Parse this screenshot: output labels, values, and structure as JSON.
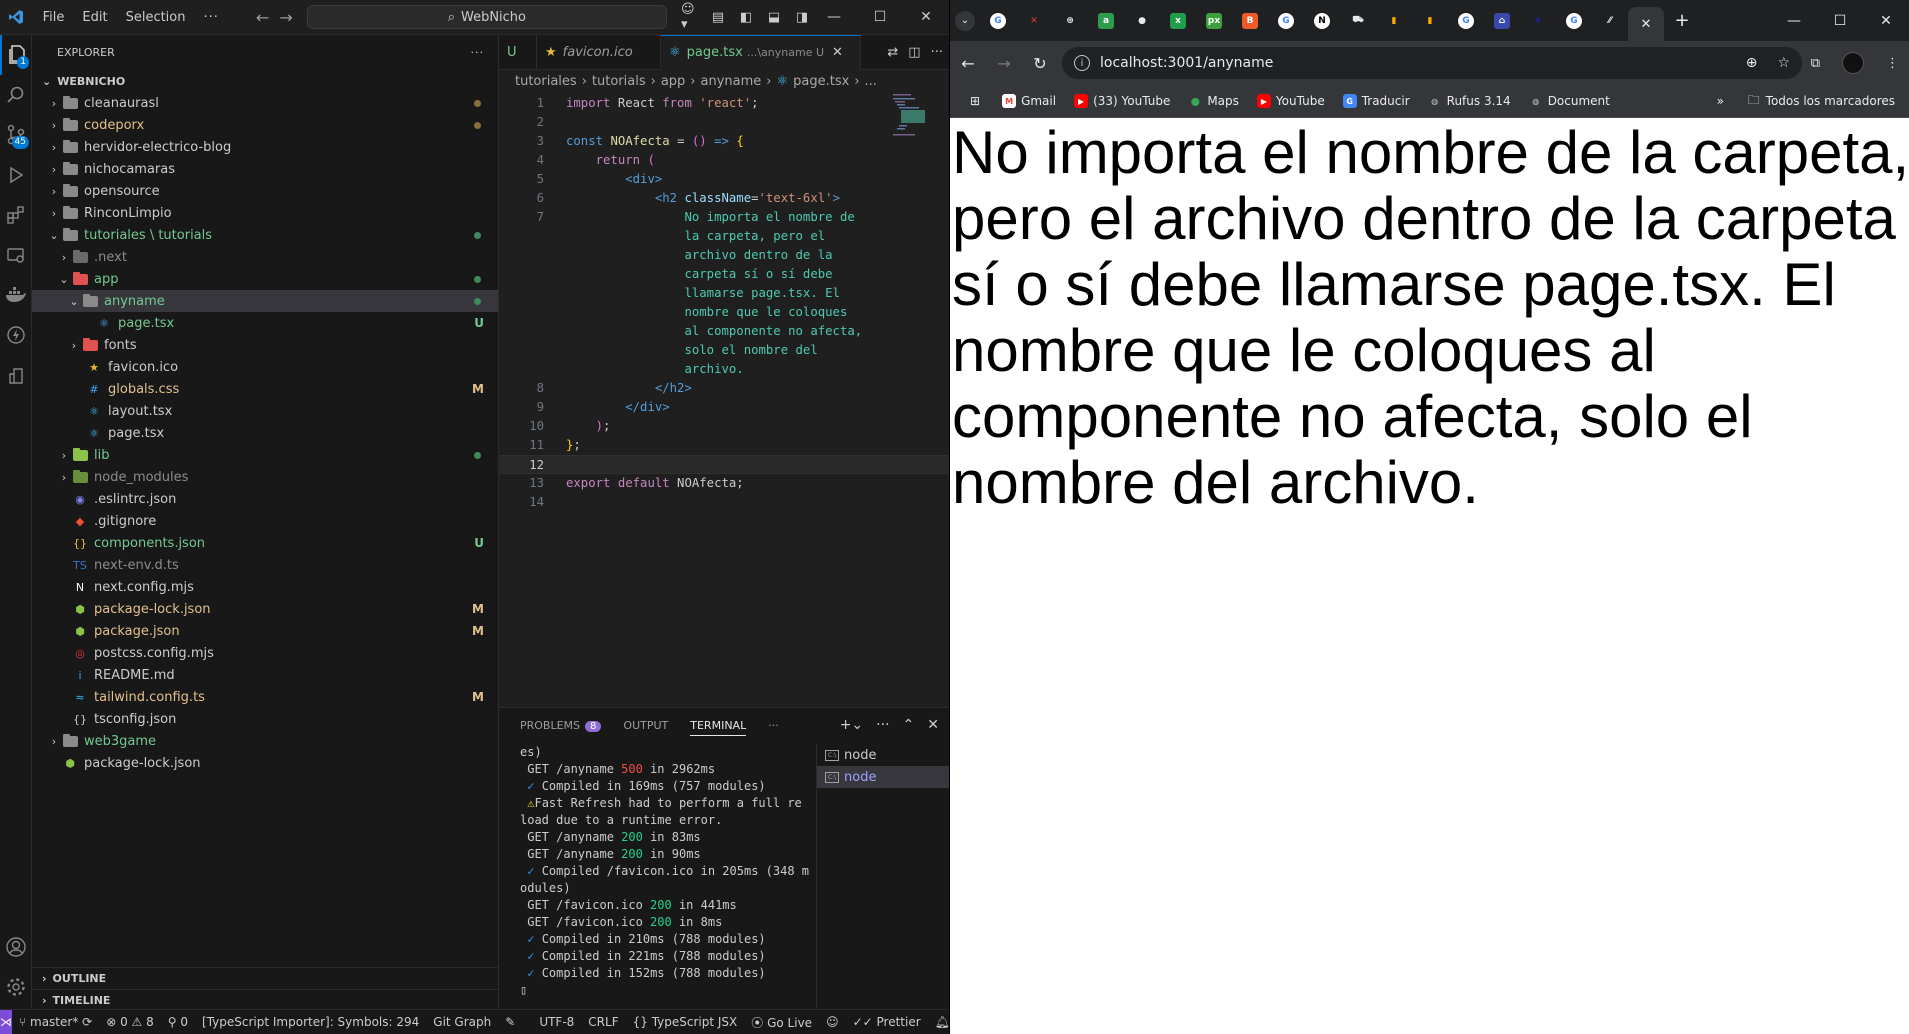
{
  "vscode": {
    "menu": [
      "File",
      "Edit",
      "Selection",
      "···"
    ],
    "search_label": "WebNicho",
    "activity_badge": "45",
    "explorer_title": "EXPLORER",
    "root_folder": "WEBNICHO",
    "tree": [
      {
        "label": "cleanaurasl",
        "depth": 0,
        "kind": "folder",
        "open": false,
        "status": "dot-mod",
        "color": "default",
        "folder_color": "#8a8a8a"
      },
      {
        "label": "codeporx",
        "depth": 0,
        "kind": "folder",
        "open": false,
        "status": "dot-mod",
        "color": "mod",
        "folder_color": "#8a8a8a"
      },
      {
        "label": "hervidor-electrico-blog",
        "depth": 0,
        "kind": "folder",
        "open": false,
        "status": "",
        "color": "default",
        "folder_color": "#8a8a8a"
      },
      {
        "label": "nichocamaras",
        "depth": 0,
        "kind": "folder",
        "open": false,
        "status": "",
        "color": "default",
        "folder_color": "#8a8a8a"
      },
      {
        "label": "opensource",
        "depth": 0,
        "kind": "folder",
        "open": false,
        "status": "",
        "color": "default",
        "folder_color": "#8a8a8a"
      },
      {
        "label": "RinconLimpio",
        "depth": 0,
        "kind": "folder",
        "open": false,
        "status": "",
        "color": "default",
        "folder_color": "#8a8a8a"
      },
      {
        "label": "tutoriales \\ tutorials",
        "depth": 0,
        "kind": "folder",
        "open": true,
        "status": "dot-new",
        "color": "untracked",
        "folder_color": "#8a8a8a"
      },
      {
        "label": ".next",
        "depth": 1,
        "kind": "folder",
        "open": false,
        "status": "",
        "color": "ignored",
        "folder_color": "#6a6a6a"
      },
      {
        "label": "app",
        "depth": 1,
        "kind": "folder",
        "open": true,
        "status": "dot-new",
        "color": "untracked",
        "folder_color": "#e05252"
      },
      {
        "label": "anyname",
        "depth": 2,
        "kind": "folder",
        "open": true,
        "status": "dot-new",
        "color": "untracked",
        "folder_color": "#8a8a8a",
        "selected": true
      },
      {
        "label": "page.tsx",
        "depth": 3,
        "kind": "react",
        "status": "U",
        "color": "untracked"
      },
      {
        "label": "fonts",
        "depth": 2,
        "kind": "folder",
        "open": false,
        "status": "",
        "color": "default",
        "folder_color": "#e05252"
      },
      {
        "label": "favicon.ico",
        "depth": 2,
        "kind": "star",
        "status": "",
        "color": "default"
      },
      {
        "label": "globals.css",
        "depth": 2,
        "kind": "css",
        "status": "M",
        "color": "mod"
      },
      {
        "label": "layout.tsx",
        "depth": 2,
        "kind": "react",
        "status": "",
        "color": "default"
      },
      {
        "label": "page.tsx",
        "depth": 2,
        "kind": "react",
        "status": "",
        "color": "default"
      },
      {
        "label": "lib",
        "depth": 1,
        "kind": "folder",
        "open": false,
        "status": "dot-new",
        "color": "untracked",
        "folder_color": "#8bc34a"
      },
      {
        "label": "node_modules",
        "depth": 1,
        "kind": "folder",
        "open": false,
        "status": "",
        "color": "ignored",
        "folder_color": "#6a8f3a"
      },
      {
        "label": ".eslintrc.json",
        "depth": 1,
        "kind": "eslint",
        "status": "",
        "color": "default"
      },
      {
        "label": ".gitignore",
        "depth": 1,
        "kind": "git",
        "status": "",
        "color": "default"
      },
      {
        "label": "components.json",
        "depth": 1,
        "kind": "json",
        "status": "U",
        "color": "untracked"
      },
      {
        "label": "next-env.d.ts",
        "depth": 1,
        "kind": "ts",
        "status": "",
        "color": "ignored"
      },
      {
        "label": "next.config.mjs",
        "depth": 1,
        "kind": "next",
        "status": "",
        "color": "default"
      },
      {
        "label": "package-lock.json",
        "depth": 1,
        "kind": "npm",
        "status": "M",
        "color": "mod"
      },
      {
        "label": "package.json",
        "depth": 1,
        "kind": "npm",
        "status": "M",
        "color": "mod"
      },
      {
        "label": "postcss.config.mjs",
        "depth": 1,
        "kind": "postcss",
        "status": "",
        "color": "default"
      },
      {
        "label": "README.md",
        "depth": 1,
        "kind": "info",
        "status": "",
        "color": "default"
      },
      {
        "label": "tailwind.config.ts",
        "depth": 1,
        "kind": "tailwind",
        "status": "M",
        "color": "mod"
      },
      {
        "label": "tsconfig.json",
        "depth": 1,
        "kind": "tsconfig",
        "status": "",
        "color": "default"
      },
      {
        "label": "web3game",
        "depth": 0,
        "kind": "folder",
        "open": false,
        "status": "",
        "color": "untracked",
        "folder_color": "#8a8a8a"
      },
      {
        "label": "package-lock.json",
        "depth": 0,
        "kind": "npm",
        "status": "",
        "color": "default"
      }
    ],
    "outline_label": "OUTLINE",
    "timeline_label": "TIMELINE",
    "tabs": [
      {
        "label": "U",
        "italic": false
      },
      {
        "label": "favicon.ico",
        "italic": true
      },
      {
        "label": "page.tsx",
        "suffix": "...\\anyname U",
        "active": true
      }
    ],
    "breadcrumb": [
      "tutoriales",
      "tutorials",
      "app",
      "anyname",
      "page.tsx",
      "..."
    ],
    "code_lines": [
      {
        "n": "1",
        "html": "<span class='kw2'>import</span> React <span class='kw2'>from</span> <span class='str'>'react'</span>;"
      },
      {
        "n": "2",
        "html": ""
      },
      {
        "n": "3",
        "html": "<span class='kw'>const</span> <span class='fn'>NOAfecta</span> = <span class='paren'>()</span> <span class='kw'>=&gt;</span> <span class='brace'>{</span>"
      },
      {
        "n": "4",
        "html": "    <span class='kw2'>return</span> <span class='paren'>(</span>"
      },
      {
        "n": "5",
        "html": "        <span class='tag'>&lt;div&gt;</span>"
      },
      {
        "n": "6",
        "html": "            <span class='tag'>&lt;h2</span> <span class='attr'>className</span>=<span class='str'>'text-6xl'</span><span class='tag'>&gt;</span>"
      },
      {
        "n": "7",
        "html": "                <span class='txt'>No importa el nombre de</span>"
      },
      {
        "n": "",
        "html": "                <span class='txt'>la carpeta, pero el</span>"
      },
      {
        "n": "",
        "html": "                <span class='txt'>archivo dentro de la</span>"
      },
      {
        "n": "",
        "html": "                <span class='txt'>carpeta sí o sí debe</span>"
      },
      {
        "n": "",
        "html": "                <span class='txt'>llamarse page.tsx. El</span>"
      },
      {
        "n": "",
        "html": "                <span class='txt'>nombre que le coloques</span>"
      },
      {
        "n": "",
        "html": "                <span class='txt'>al componente no afecta,</span>"
      },
      {
        "n": "",
        "html": "                <span class='txt'>solo el nombre del</span>"
      },
      {
        "n": "",
        "html": "                <span class='txt'>archivo.</span>"
      },
      {
        "n": "8",
        "html": "            <span class='tag'>&lt;/h2&gt;</span>"
      },
      {
        "n": "9",
        "html": "        <span class='tag'>&lt;/div&gt;</span>"
      },
      {
        "n": "10",
        "html": "    <span class='paren'>)</span>;"
      },
      {
        "n": "11",
        "html": "<span class='brace'>}</span>;"
      },
      {
        "n": "12",
        "html": "",
        "current": true
      },
      {
        "n": "13",
        "html": "<span class='kw2'>export</span> <span class='kw2'>default</span> NOAfecta;"
      },
      {
        "n": "14",
        "html": ""
      }
    ],
    "panel_tabs": {
      "problems": "PROBLEMS",
      "problems_count": "8",
      "output": "OUTPUT",
      "terminal": "TERMINAL"
    },
    "terminal_lines": [
      "es)",
      " GET /anyname <span class='t-red'>500</span> in 2962ms",
      " <span class='t-check'>✓</span> Compiled in 169ms (757 modules)",
      " <span class='t-warn'>⚠</span>Fast Refresh had to perform a full re",
      "load due to a runtime error.",
      " GET /anyname <span class='t-green'>200</span> in 83ms",
      " GET /anyname <span class='t-green'>200</span> in 90ms",
      " <span class='t-check'>✓</span> Compiled /favicon.ico in 205ms (348 m",
      "odules)",
      " GET /favicon.ico <span class='t-green'>200</span> in 441ms",
      " GET /favicon.ico <span class='t-green'>200</span> in 8ms",
      " <span class='t-check'>✓</span> Compiled in 210ms (788 modules)",
      " <span class='t-check'>✓</span> Compiled in 221ms (788 modules)",
      " <span class='t-check'>✓</span> Compiled in 152ms (788 modules)",
      "▯"
    ],
    "terminals": [
      {
        "label": "node",
        "active": false
      },
      {
        "label": "node",
        "active": true
      }
    ],
    "status": {
      "branch": "master*",
      "errors": "0",
      "warnings": "8",
      "ports": "0",
      "ts_importer": "[TypeScript Importer]: Symbols: 294",
      "git_graph": "Git Graph",
      "encoding": "UTF-8",
      "eol": "CRLF",
      "language": "TypeScript JSX",
      "golive": "Go Live",
      "prettier": "Prettier"
    }
  },
  "chrome": {
    "tab_favicons": [
      {
        "icon": "google-icon",
        "bg": "#ffffff",
        "fg": "#4285f4",
        "ch": "G"
      },
      {
        "icon": "x-icon",
        "bg": "#1f2022",
        "fg": "#e53935",
        "ch": "✕"
      },
      {
        "icon": "chatgpt-icon",
        "bg": "#1f2022",
        "fg": "#e8eaed",
        "ch": "⊛"
      },
      {
        "icon": "app-icon",
        "bg": "#2e9b4e",
        "fg": "#ffffff",
        "ch": "a"
      },
      {
        "icon": "github-icon",
        "bg": "#1f2022",
        "fg": "#e8eaed",
        "ch": "●"
      },
      {
        "icon": "excel-icon",
        "bg": "#1e9e4a",
        "fg": "#ffffff",
        "ch": "x"
      },
      {
        "icon": "px-icon",
        "bg": "#3ca13c",
        "fg": "#ffffff",
        "ch": "px"
      },
      {
        "icon": "brave-icon",
        "bg": "#f05a28",
        "fg": "#ffffff",
        "ch": "B"
      },
      {
        "icon": "google-icon",
        "bg": "#ffffff",
        "fg": "#4285f4",
        "ch": "G"
      },
      {
        "icon": "notion-icon",
        "bg": "#ffffff",
        "fg": "#000000",
        "ch": "N"
      },
      {
        "icon": "car-icon",
        "bg": "#1f2022",
        "fg": "#e8eaed",
        "ch": "⛟"
      },
      {
        "icon": "analytics-icon",
        "bg": "#1f2022",
        "fg": "#f9ab00",
        "ch": "▮"
      },
      {
        "icon": "analytics-icon",
        "bg": "#1f2022",
        "fg": "#f9ab00",
        "ch": "▮"
      },
      {
        "icon": "google-icon",
        "bg": "#ffffff",
        "fg": "#4285f4",
        "ch": "G"
      },
      {
        "icon": "rss-icon",
        "bg": "#3949ab",
        "fg": "#ffffff",
        "ch": "⌂"
      },
      {
        "icon": "star-icon",
        "bg": "#1f2022",
        "fg": "#1a237e",
        "ch": "✱"
      },
      {
        "icon": "google-icon",
        "bg": "#ffffff",
        "fg": "#4285f4",
        "ch": "G"
      },
      {
        "icon": "slash-icon",
        "bg": "#1f2022",
        "fg": "#e8eaed",
        "ch": "⁄⁄"
      }
    ],
    "url": "localhost:3001/anyname",
    "bookmarks": [
      {
        "label": "Gmail",
        "icon": "gmail-icon",
        "bg": "#ffffff",
        "fg": "#ea4335",
        "ch": "M"
      },
      {
        "label": "(33) YouTube",
        "icon": "youtube-icon",
        "bg": "#ff0000",
        "fg": "#ffffff",
        "ch": "▶"
      },
      {
        "label": "Maps",
        "icon": "maps-icon",
        "bg": "#35363a",
        "fg": "#34a853",
        "ch": "⬤"
      },
      {
        "label": "YouTube",
        "icon": "youtube-icon",
        "bg": "#ff0000",
        "fg": "#ffffff",
        "ch": "▶"
      },
      {
        "label": "Traducir",
        "icon": "translate-icon",
        "bg": "#4285f4",
        "fg": "#ffffff",
        "ch": "G"
      },
      {
        "label": "Rufus 3.14",
        "icon": "globe-icon",
        "bg": "#35363a",
        "fg": "#c4c7c5",
        "ch": "◍"
      },
      {
        "label": "Document",
        "icon": "globe-icon",
        "bg": "#35363a",
        "fg": "#c4c7c5",
        "ch": "◍"
      }
    ],
    "all_bookmarks": "Todos los marcadores",
    "page_heading": "No importa el nombre de la carpeta, pero el archivo dentro de la carpeta sí o sí debe llamarse page.tsx. El nombre que le coloques al componente no afecta, solo el nombre del archivo."
  }
}
